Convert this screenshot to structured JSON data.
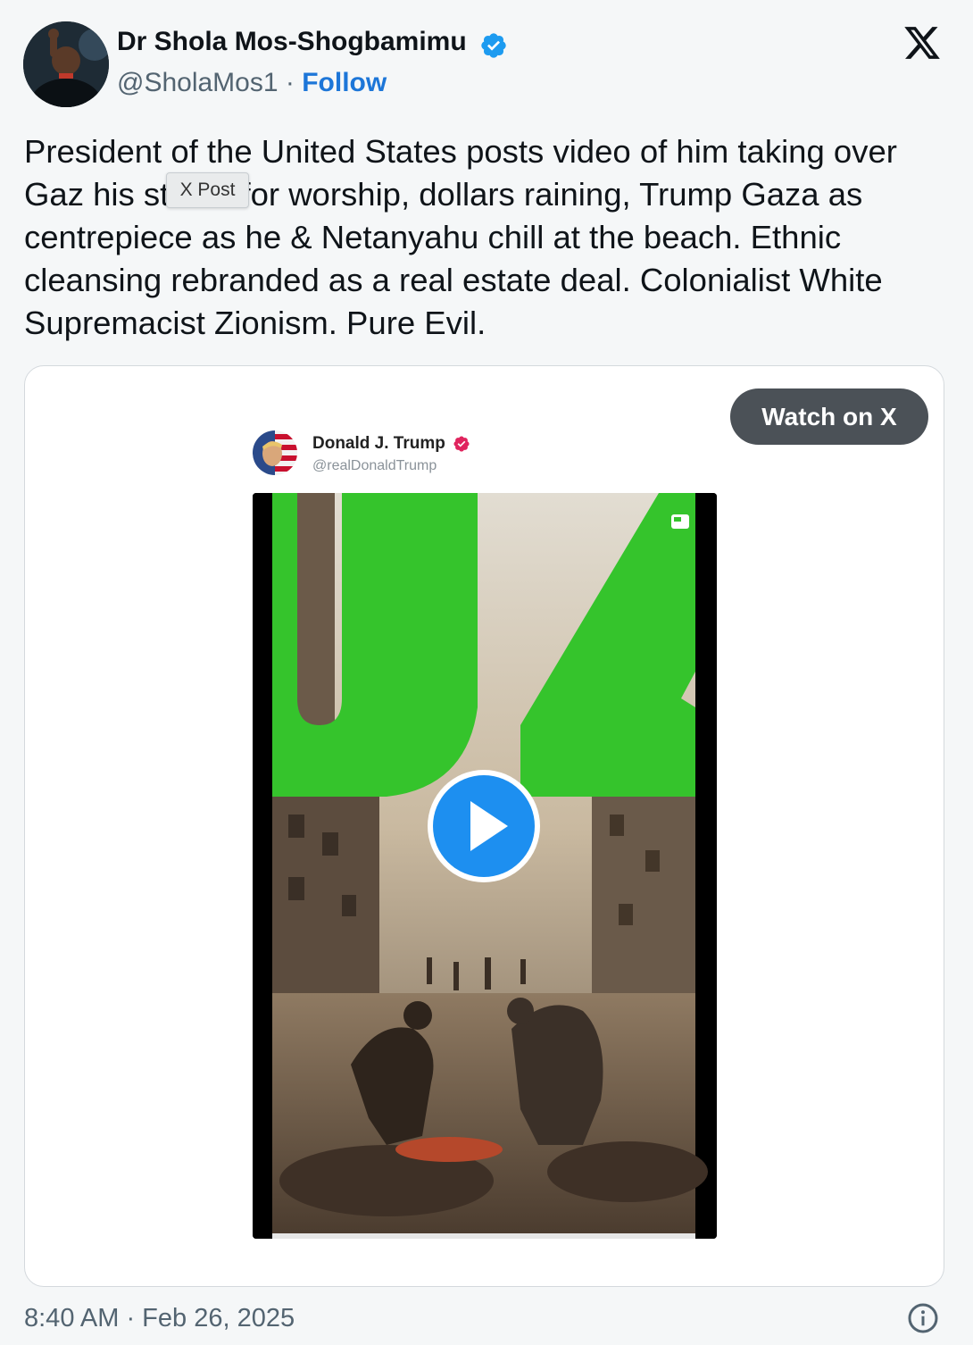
{
  "author": {
    "name": "Dr Shola Mos-Shogbamimu",
    "handle": "@SholaMos1",
    "separator": " · ",
    "follow_label": "Follow"
  },
  "tweet": {
    "text_before_tooltip": "President of the United States posts video of him taking over Gaz",
    "text_after_tooltip": " his statue for worship, dollars raining, Trump Gaza as centrepiece as he & Netanyahu chill at the beach. Ethnic cleansing rebranded as a real estate deal. Colonialist White Supremacist Zionism. Pure Evil.",
    "hover_tooltip": "X Post"
  },
  "card": {
    "watch_label": "Watch on X",
    "embedded_author_name": "Donald J. Trump",
    "embedded_author_handle": "@realDonaldTrump"
  },
  "footer": {
    "timestamp": "8:40 AM · Feb 26, 2025"
  },
  "colors": {
    "accent": "#1d76d8",
    "verified_blue": "#1d9bf0",
    "verified_pink": "#e0245e",
    "play_blue": "#1d8ff0",
    "video_green": "#35c42c"
  },
  "icons": [
    "verified-badge-icon",
    "x-logo-icon",
    "play-icon",
    "caption-icon",
    "info-icon"
  ]
}
